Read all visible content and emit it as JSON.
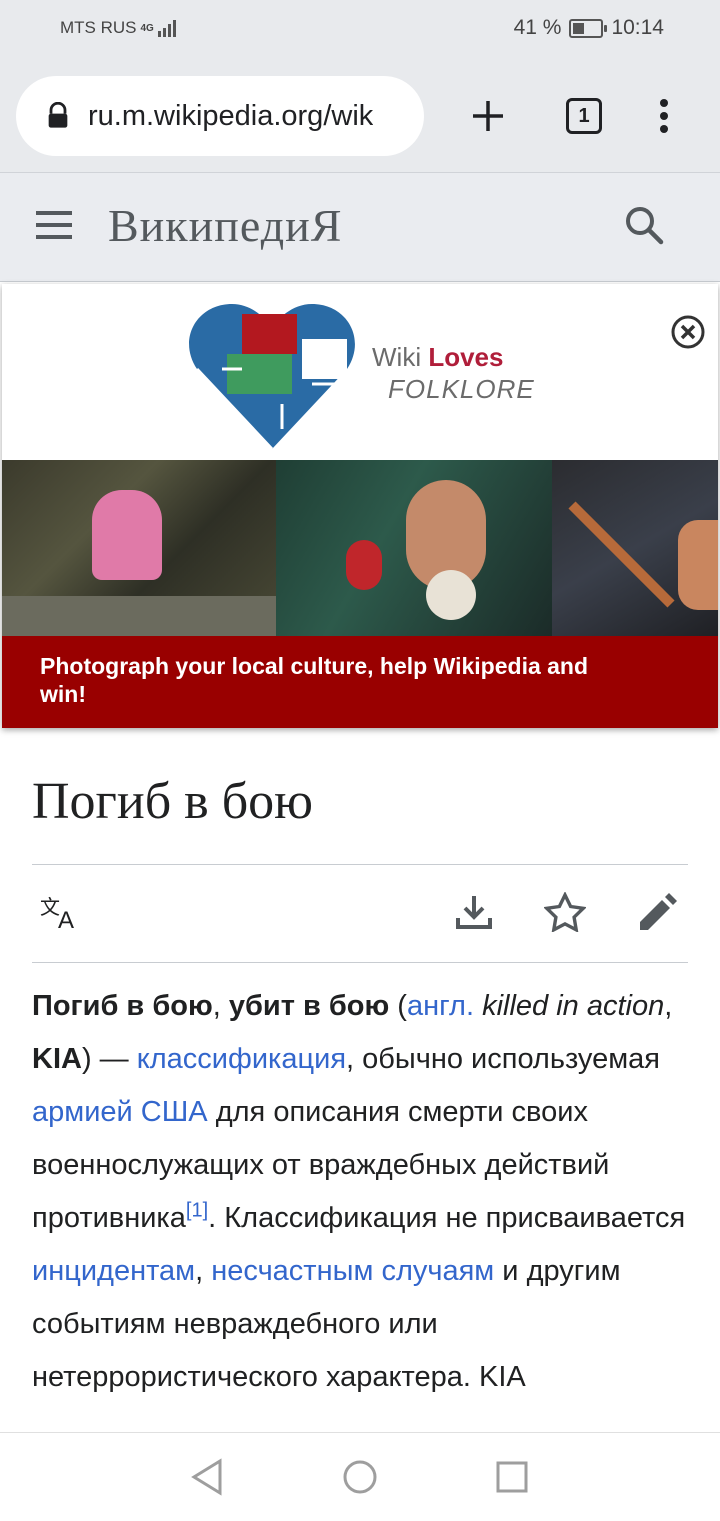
{
  "status": {
    "carrier": "MTS RUS",
    "network": "4G",
    "battery": "41 %",
    "time": "10:14"
  },
  "browser": {
    "url": "ru.m.wikipedia.org/wik",
    "tab_count": "1"
  },
  "site": {
    "logo": "ВикипедиЯ"
  },
  "banner": {
    "logo_wiki": "Wiki",
    "logo_loves": "Loves",
    "logo_folklore": "FOLKLORE",
    "cta": "Photograph your local culture, help Wikipedia and win!"
  },
  "article": {
    "title": "Погиб в бою",
    "p1_b1": "Погиб в бою",
    "p1_t1": ", ",
    "p1_b2": "убит в бою",
    "p1_t2": " (",
    "p1_link1": "англ.",
    "p1_t3": " ",
    "p1_i1": "killed in action",
    "p1_t4": ", ",
    "p1_b3": "KIA",
    "p1_t5": ") — ",
    "p1_link2": "классификация",
    "p1_t6": ", обычно используемая ",
    "p1_link3": "армией США",
    "p1_t7": " для описания смерти своих военнослужащих от враждебных действий противника",
    "p1_ref": "[1]",
    "p1_t8": ". Классификация не присваивается ",
    "p1_link4": "инцидентам",
    "p1_t9": ", ",
    "p1_link5": "несчастным случаям",
    "p1_t10": " и другим событиям невраждебного или нетеррористического характера. KIA"
  },
  "colors": {
    "link": "#3366cc",
    "banner_red": "#990000",
    "header_bg": "#eaecf0"
  }
}
